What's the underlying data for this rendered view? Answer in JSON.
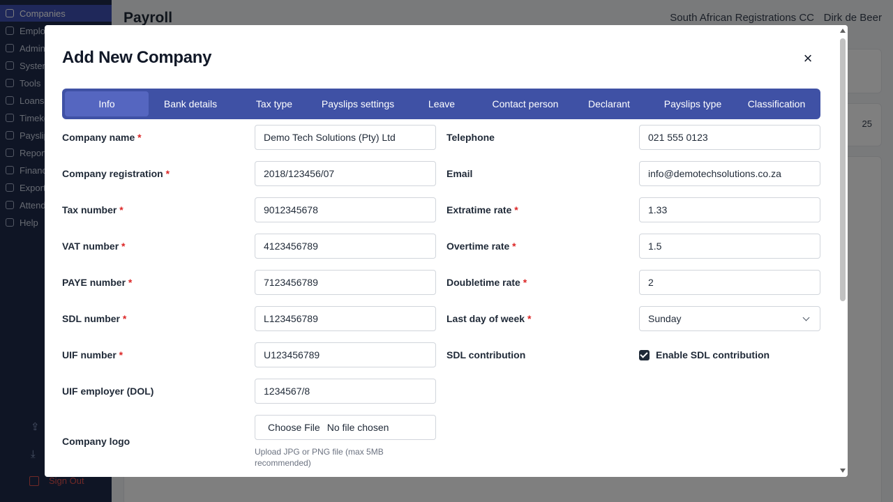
{
  "sidebar": {
    "items": [
      {
        "label": "Companies",
        "icon": "home-icon",
        "active": true
      },
      {
        "label": "Employees",
        "icon": "users-icon"
      },
      {
        "label": "Admin",
        "icon": "gear-icon"
      },
      {
        "label": "System",
        "icon": "wrench-icon"
      },
      {
        "label": "Tools",
        "icon": "toolbox-icon"
      },
      {
        "label": "Loans",
        "icon": "dollar-icon"
      },
      {
        "label": "Timekeeping",
        "icon": "clock-icon"
      },
      {
        "label": "Payslips",
        "icon": "document-icon"
      },
      {
        "label": "Reports",
        "icon": "report-icon"
      },
      {
        "label": "Finance",
        "icon": "finance-icon"
      },
      {
        "label": "Exports",
        "icon": "download-icon"
      },
      {
        "label": "Attendance",
        "icon": "clock-icon"
      },
      {
        "label": "Help",
        "icon": "gear-icon"
      }
    ],
    "sign_out": "Sign Out"
  },
  "header": {
    "title": "Payroll",
    "company": "South African Registrations CC",
    "user": "Dirk de Beer",
    "page_size_value": "25"
  },
  "modal": {
    "title": "Add New Company",
    "close_glyph": "×",
    "tabs": [
      "Info",
      "Bank details",
      "Tax type",
      "Payslips settings",
      "Leave",
      "Contact person",
      "Declarant",
      "Payslips type",
      "Classification"
    ],
    "active_tab": "Info",
    "required_marker": "*",
    "fields_left": [
      {
        "label": "Company name",
        "required": true,
        "value": "Demo Tech Solutions (Pty) Ltd"
      },
      {
        "label": "Company registration",
        "required": true,
        "value": "2018/123456/07"
      },
      {
        "label": "Tax number",
        "required": true,
        "value": "9012345678"
      },
      {
        "label": "VAT number",
        "required": true,
        "value": "4123456789"
      },
      {
        "label": "PAYE number",
        "required": true,
        "value": "7123456789"
      },
      {
        "label": "SDL number",
        "required": true,
        "value": "L123456789"
      },
      {
        "label": "UIF number",
        "required": true,
        "value": "U123456789"
      },
      {
        "label": "UIF employer (DOL)",
        "required": false,
        "value": "1234567/8"
      }
    ],
    "fields_right": [
      {
        "label": "Telephone",
        "required": false,
        "value": "021 555 0123"
      },
      {
        "label": "Email",
        "required": false,
        "value": "info@demotechsolutions.co.za"
      },
      {
        "label": "Extratime rate",
        "required": true,
        "value": "1.33"
      },
      {
        "label": "Overtime rate",
        "required": true,
        "value": "1.5"
      },
      {
        "label": "Doubletime rate",
        "required": true,
        "value": "2"
      }
    ],
    "last_day": {
      "label": "Last day of week",
      "value": "Sunday"
    },
    "sdl_contribution": {
      "label": "SDL contribution",
      "checkbox_label": "Enable SDL contribution",
      "checked": true
    },
    "logo": {
      "label": "Company logo",
      "button": "Choose File",
      "status": "No file chosen",
      "hint": "Upload JPG or PNG file (max 5MB recommended)"
    }
  },
  "colors": {
    "sidebar": "#1e2a4a",
    "accent": "#3f51a5",
    "active_tab": "#5566c0",
    "required": "#dc2626"
  }
}
